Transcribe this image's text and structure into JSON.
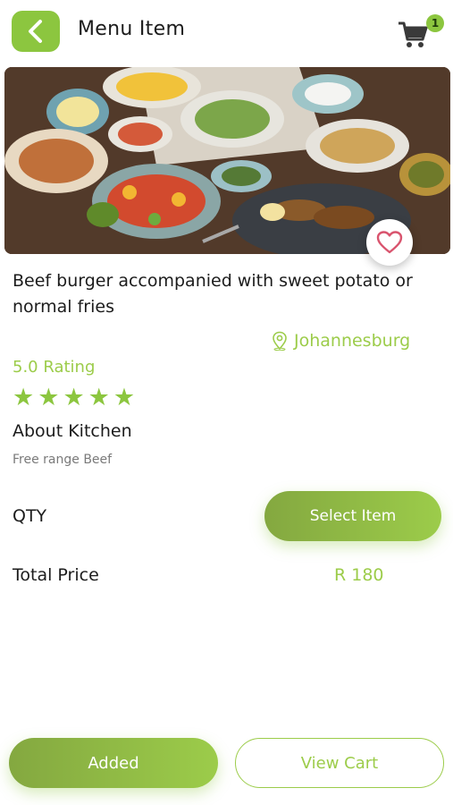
{
  "header": {
    "title": "Menu Item",
    "back_icon": "chevron-left-icon",
    "cart_icon": "shopping-cart-icon",
    "cart_count": "1"
  },
  "item": {
    "title": "Beef burger accompanied with sweet potato or normal fries",
    "location": "Johannesburg",
    "rating_text": "5.0 Rating",
    "stars": 5,
    "about_title": "About Kitchen",
    "about_text": "Free range Beef"
  },
  "order": {
    "qty_label": "QTY",
    "select_label": "Select Item",
    "price_label": "Total Price",
    "price_value": "R 180"
  },
  "actions": {
    "added_label": "Added",
    "view_cart_label": "View Cart"
  },
  "colors": {
    "accent": "#8cc63f",
    "accent_text": "#9ccc4a",
    "heart": "#d9546e"
  }
}
